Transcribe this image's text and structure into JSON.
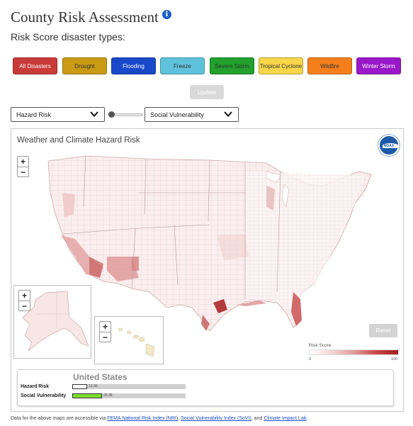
{
  "header": {
    "title": "County Risk Assessment",
    "info_icon": "info-icon"
  },
  "subtitle": "Risk Score disaster types:",
  "disaster_buttons": [
    {
      "label": "All Disasters",
      "color": "#c93b38",
      "text_color": "#ffffff"
    },
    {
      "label": "Drought",
      "color": "#c99a13",
      "text_color": "#333333"
    },
    {
      "label": "Flooding",
      "color": "#1948c9",
      "text_color": "#ffffff"
    },
    {
      "label": "Freeze",
      "color": "#5fc2dc",
      "text_color": "#333333"
    },
    {
      "label": "Severe Storm",
      "color": "#22a12c",
      "text_color": "#333333"
    },
    {
      "label": "Tropical Cyclone",
      "color": "#f7d64a",
      "text_color": "#333333"
    },
    {
      "label": "Wildfire",
      "color": "#f47f1b",
      "text_color": "#333333"
    },
    {
      "label": "Winter Storm",
      "color": "#9a18c9",
      "text_color": "#ffffff"
    }
  ],
  "update_label": "Update",
  "selects": {
    "left": "Hazard Risk",
    "right": "Social Vulnerability"
  },
  "map": {
    "title": "Weather and Climate Hazard Risk",
    "logo_text": "NOAA",
    "zoom_in": "+",
    "zoom_out": "−",
    "reset_label": "Reset",
    "legend": {
      "title": "Risk Score",
      "min": "0",
      "max": "100"
    }
  },
  "summary": {
    "title": "United States",
    "rows": [
      {
        "label": "Hazard Risk",
        "value": "13.30",
        "fraction": 0.133,
        "color": "#ffffff"
      },
      {
        "label": "Social Vulnerability",
        "value": "26.35",
        "fraction": 0.2635,
        "color": "#7ddc2e"
      }
    ]
  },
  "footer": {
    "prefix": "Data for the above maps are accessible via ",
    "link1": "FEMA National Risk Index (NRI)",
    "sep1": ", ",
    "link2": "Social Vulnerability Index (SoVI)",
    "sep2": ", and ",
    "link3": "Climate Impact Lab",
    "suffix": "."
  }
}
